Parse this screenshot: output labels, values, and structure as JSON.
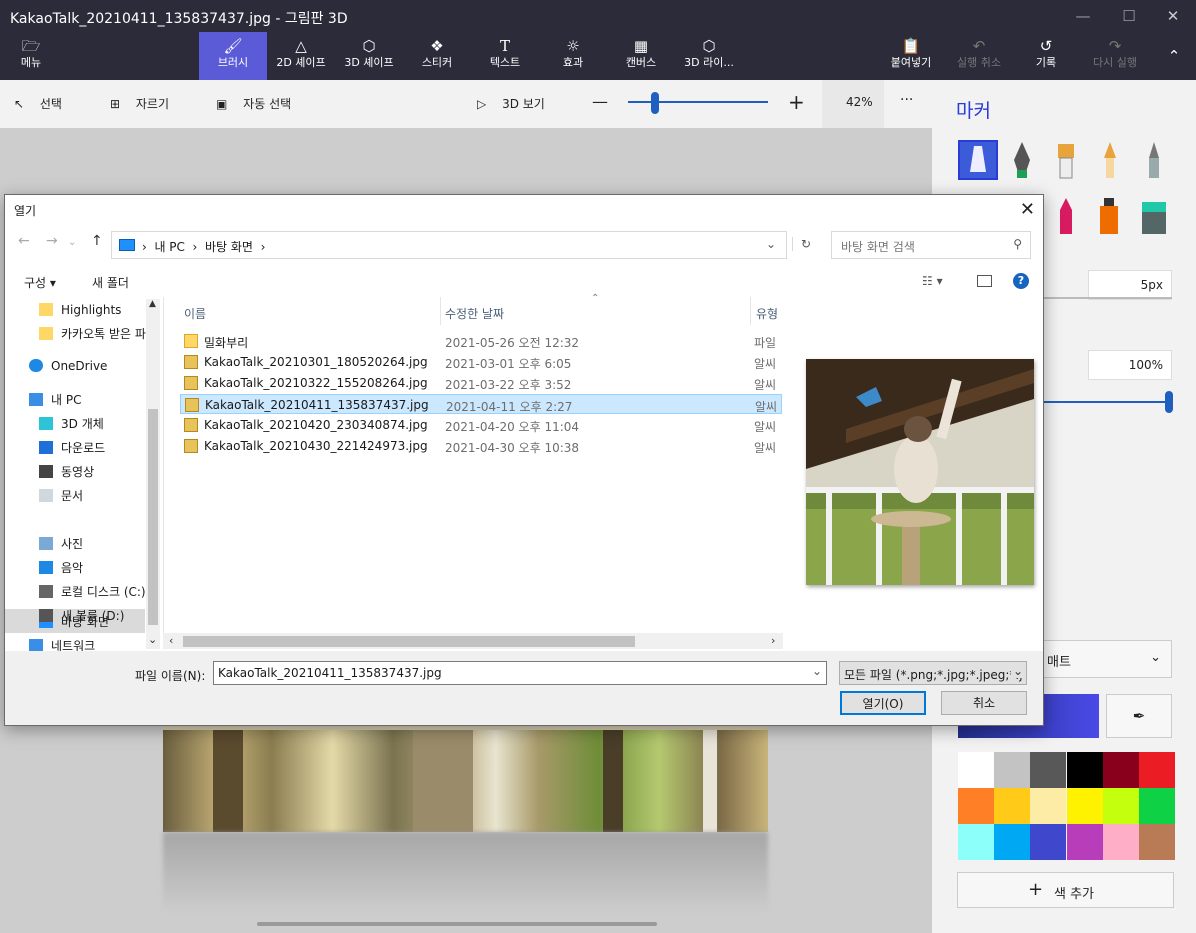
{
  "window": {
    "title": "KakaoTalk_20210411_135837437.jpg - 그림판 3D",
    "controls": {
      "minimize": "—",
      "maximize": "☐",
      "close": "✕"
    }
  },
  "ribbon": {
    "menu": "메뉴",
    "tabs": [
      {
        "label": "브러시"
      },
      {
        "label": "2D 셰이프"
      },
      {
        "label": "3D 셰이프"
      },
      {
        "label": "스티커"
      },
      {
        "label": "텍스트"
      },
      {
        "label": "효과"
      },
      {
        "label": "캔버스"
      },
      {
        "label": "3D 라이..."
      }
    ],
    "paste": "붙여넣기",
    "undo": "실행 취소",
    "history": "기록",
    "redo": "다시 실행"
  },
  "toolbar": {
    "select": "선택",
    "crop": "자르기",
    "magic_select": "자동 선택",
    "view3d": "3D 보기",
    "zoom": "42%",
    "zoom_level": 0.42,
    "more": "···"
  },
  "panel": {
    "title": "마커",
    "thickness": "5px",
    "opacity": "100%",
    "color_section": "매트",
    "add_color": "색 추가",
    "swatches": [
      "#ffffff",
      "#c3c3c3",
      "#585858",
      "#000000",
      "#88001b",
      "#ec1c24",
      "#ff7f27",
      "#ffca18",
      "#fdeca6",
      "#fff200",
      "#c4ff0e",
      "#0ed145",
      "#8cfffb",
      "#00a8f3",
      "#3f48cc",
      "#b83dba",
      "#ffaec8",
      "#b97a56"
    ]
  },
  "dialog": {
    "title": "열기",
    "address": {
      "root": "내 PC",
      "folder": "바탕 화면"
    },
    "search_placeholder": "바탕 화면 검색",
    "organize": "구성 ▾",
    "new_folder": "새 폴더",
    "tree": [
      {
        "label": "Highlights",
        "icon": "folder-icon"
      },
      {
        "label": "카카오톡 받은 파",
        "icon": "folder-icon"
      },
      {
        "label": "OneDrive",
        "icon": "cloud-icon"
      },
      {
        "label": "내 PC",
        "icon": "pc-icon"
      },
      {
        "label": "3D 개체",
        "icon": "cube-icon"
      },
      {
        "label": "다운로드",
        "icon": "download-icon"
      },
      {
        "label": "동영상",
        "icon": "video-icon"
      },
      {
        "label": "문서",
        "icon": "document-icon"
      },
      {
        "label": "바탕 화면",
        "icon": "desktop-icon"
      },
      {
        "label": "사진",
        "icon": "picture-icon"
      },
      {
        "label": "음악",
        "icon": "music-icon"
      },
      {
        "label": "로컬 디스크 (C:)",
        "icon": "disk-icon"
      },
      {
        "label": "새 볼륨 (D:)",
        "icon": "drive-icon"
      },
      {
        "label": "네트워크",
        "icon": "network-icon"
      }
    ],
    "columns": {
      "name": "이름",
      "date": "수정한 날짜",
      "type": "유형"
    },
    "files": [
      {
        "name": "밀화부리",
        "date": "2021-05-26 오전 12:32",
        "type": "파일",
        "kind": "folder"
      },
      {
        "name": "KakaoTalk_20210301_180520264.jpg",
        "date": "2021-03-01 오후 6:05",
        "type": "알씨",
        "kind": "jpg"
      },
      {
        "name": "KakaoTalk_20210322_155208264.jpg",
        "date": "2021-03-22 오후 3:52",
        "type": "알씨",
        "kind": "jpg"
      },
      {
        "name": "KakaoTalk_20210411_135837437.jpg",
        "date": "2021-04-11 오후 2:27",
        "type": "알씨",
        "kind": "jpg",
        "selected": true
      },
      {
        "name": "KakaoTalk_20210420_230340874.jpg",
        "date": "2021-04-20 오후 11:04",
        "type": "알씨",
        "kind": "jpg"
      },
      {
        "name": "KakaoTalk_20210430_221424973.jpg",
        "date": "2021-04-30 오후 10:38",
        "type": "알씨",
        "kind": "jpg"
      }
    ],
    "filename_label": "파일 이름(N):",
    "filename_value": "KakaoTalk_20210411_135837437.jpg",
    "filetype": "모든 파일 (*.png;*.jpg;*.jpeg;*.j",
    "open_button": "열기(O)",
    "cancel_button": "취소"
  }
}
